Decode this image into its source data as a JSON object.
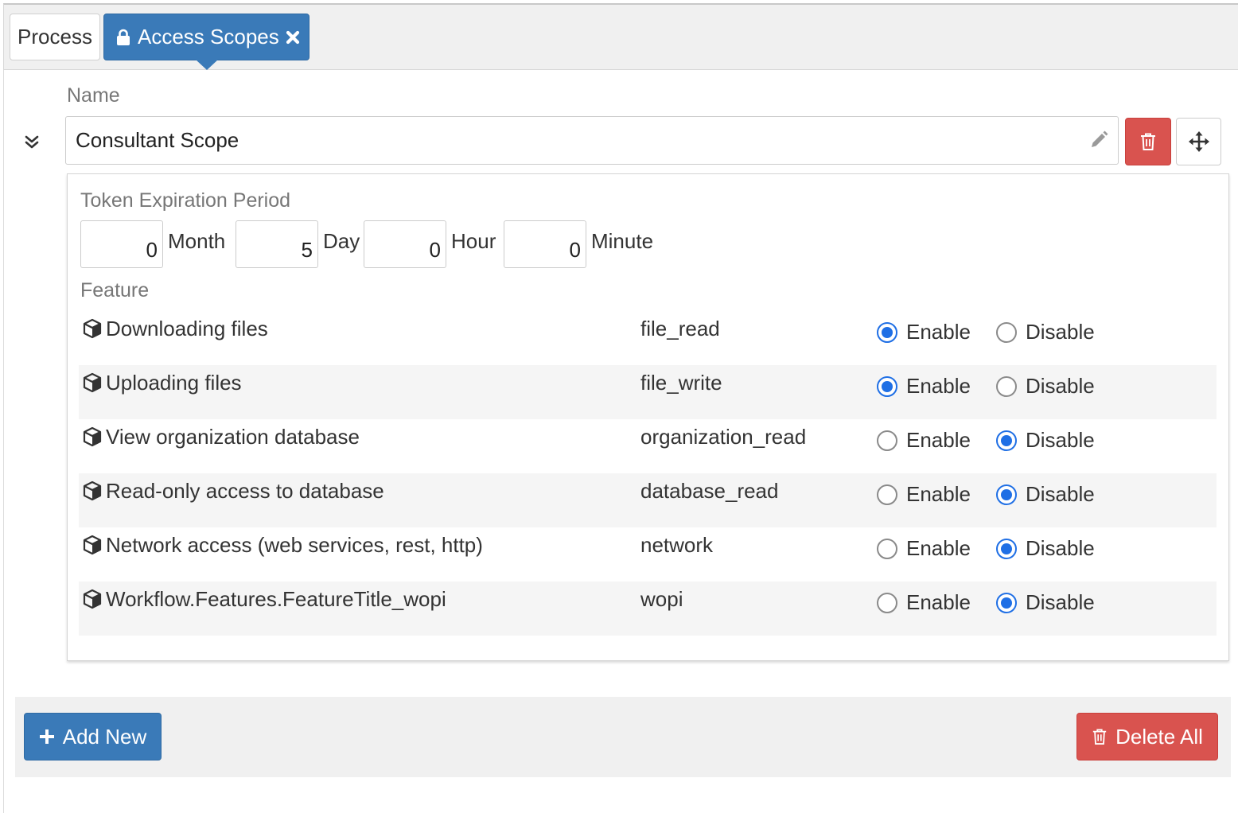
{
  "tabs": [
    {
      "label": "Process",
      "active": false
    },
    {
      "label": "Access Scopes",
      "active": true
    }
  ],
  "scope": {
    "name_label": "Name",
    "name_value": "Consultant Scope"
  },
  "token": {
    "label": "Token Expiration Period",
    "fields": [
      {
        "value": "0",
        "unit": "Month"
      },
      {
        "value": "5",
        "unit": "Day"
      },
      {
        "value": "0",
        "unit": "Hour"
      },
      {
        "value": "0",
        "unit": "Minute"
      }
    ]
  },
  "feature_label": "Feature",
  "radio_labels": {
    "enable": "Enable",
    "disable": "Disable"
  },
  "features": [
    {
      "title": "Downloading files",
      "code": "file_read",
      "enabled": true
    },
    {
      "title": "Uploading files",
      "code": "file_write",
      "enabled": true
    },
    {
      "title": "View organization database",
      "code": "organization_read",
      "enabled": false
    },
    {
      "title": "Read-only access to database",
      "code": "database_read",
      "enabled": false
    },
    {
      "title": "Network access (web services, rest, http)",
      "code": "network",
      "enabled": false
    },
    {
      "title": "Workflow.Features.FeatureTitle_wopi",
      "code": "wopi",
      "enabled": false
    }
  ],
  "footer": {
    "add_label": "Add New",
    "delete_all_label": "Delete All"
  },
  "colors": {
    "primary": "#3a7ab8",
    "danger": "#d9534f",
    "radio_selected": "#1f6fe5"
  },
  "icons": {
    "tab_lock": "lock-icon",
    "tab_close": "close-icon",
    "collapse": "double-chevron-down-icon",
    "edit": "pencil-icon",
    "delete": "trash-icon",
    "move": "move-arrows-icon",
    "feature": "cube-icon",
    "add": "plus-icon"
  }
}
